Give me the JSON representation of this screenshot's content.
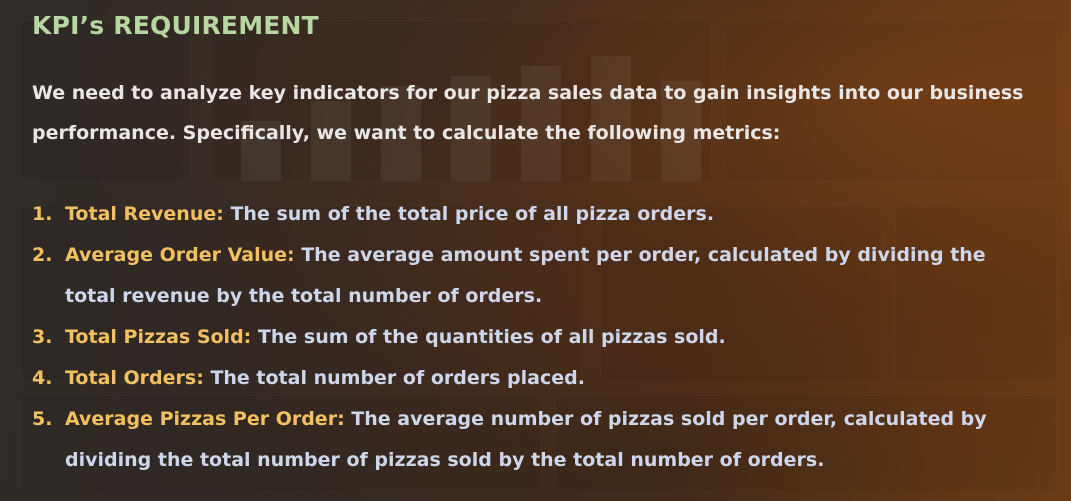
{
  "title": "KPI’s REQUIREMENT",
  "intro": "We need to analyze key indicators for our pizza sales data to gain insights into our business performance. Specifically, we want to calculate the following metrics:",
  "metrics": [
    {
      "number": "1.",
      "term": "Total Revenue:",
      "description": "The sum of the total price of all pizza orders."
    },
    {
      "number": "2.",
      "term": "Average Order Value:",
      "description": "The average amount spent per order, calculated by dividing the total revenue by the total number of orders."
    },
    {
      "number": "3.",
      "term": "Total Pizzas Sold:",
      "description": "The sum of the quantities of all pizzas sold."
    },
    {
      "number": "4.",
      "term": "Total Orders:",
      "description": "The total number of orders placed."
    },
    {
      "number": "5.",
      "term": "Average Pizzas Per Order:",
      "description": "The average number of pizzas sold per order, calculated by dividing the total number of pizzas sold by the total number of orders."
    }
  ],
  "colors": {
    "title": "#b7d7a0",
    "intro_text": "#e9e6e6",
    "metric_term": "#f2c060",
    "metric_text": "#cdd6ea",
    "background_dark": "#3a3632",
    "background_accent": "#8a4c18"
  }
}
